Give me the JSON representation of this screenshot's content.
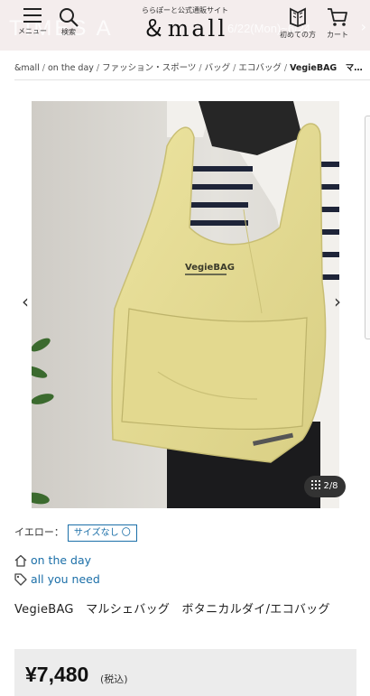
{
  "header": {
    "menu_label": "メニュー",
    "search_label": "検索",
    "tagline": "ららぽーと公式通販サイト",
    "logo": "＆mall",
    "guide_label": "初めての方",
    "cart_label": "カート",
    "ghost_text_left": "TIMES A",
    "ghost_text_right": "6/22(Mon)~6/24"
  },
  "breadcrumb": {
    "items": [
      "&mall",
      "on the day",
      "ファッション・スポーツ",
      "バッグ",
      "エコバッグ"
    ],
    "current": "VegieBAG　マ…"
  },
  "gallery": {
    "counter": "2/8",
    "current_index": 2,
    "total": 8,
    "bag_print": "VegieBAG",
    "prev_icon": "chevron-left-icon",
    "next_icon": "chevron-right-icon"
  },
  "variation": {
    "color_label": "イエロー：",
    "size_label": "サイズなし",
    "size_symbol": "〇"
  },
  "shop_links": [
    {
      "icon": "home-icon",
      "label": "on the day"
    },
    {
      "icon": "tag-icon",
      "label": "all you need"
    }
  ],
  "product": {
    "title": "VegieBAG　マルシェバッグ　ボタニカルダイ/エコバッグ",
    "price": "¥7,480",
    "tax_note": "(税込)"
  },
  "colors": {
    "header_bg": "#f4eded",
    "link": "#1b6fa8",
    "bag": "#e8df98",
    "price_bg": "#ececec"
  }
}
